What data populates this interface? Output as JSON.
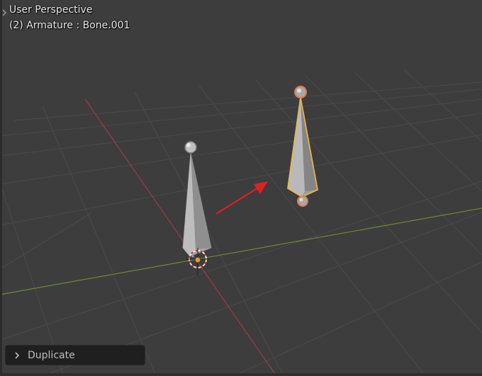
{
  "viewport": {
    "view_title": "User Perspective",
    "object_info": "(2) Armature : Bone.001"
  },
  "operator_panel": {
    "label": "Duplicate"
  },
  "colors": {
    "background": "#3d3d3d",
    "grid": "#4a4a4a",
    "x_axis": "#9b3c46",
    "y_axis": "#6b8a2e",
    "bone_idle": "#a9a9a9",
    "bone_selected_outline": "#e8b84a",
    "joint_selected": "#e27a4a",
    "annotation_arrow": "#e02020"
  },
  "icons": {
    "operator_toggle": "chevron-right-icon",
    "sidebar_toggle": "chevron-right-icon",
    "cursor_3d": "crosshair-icon"
  }
}
